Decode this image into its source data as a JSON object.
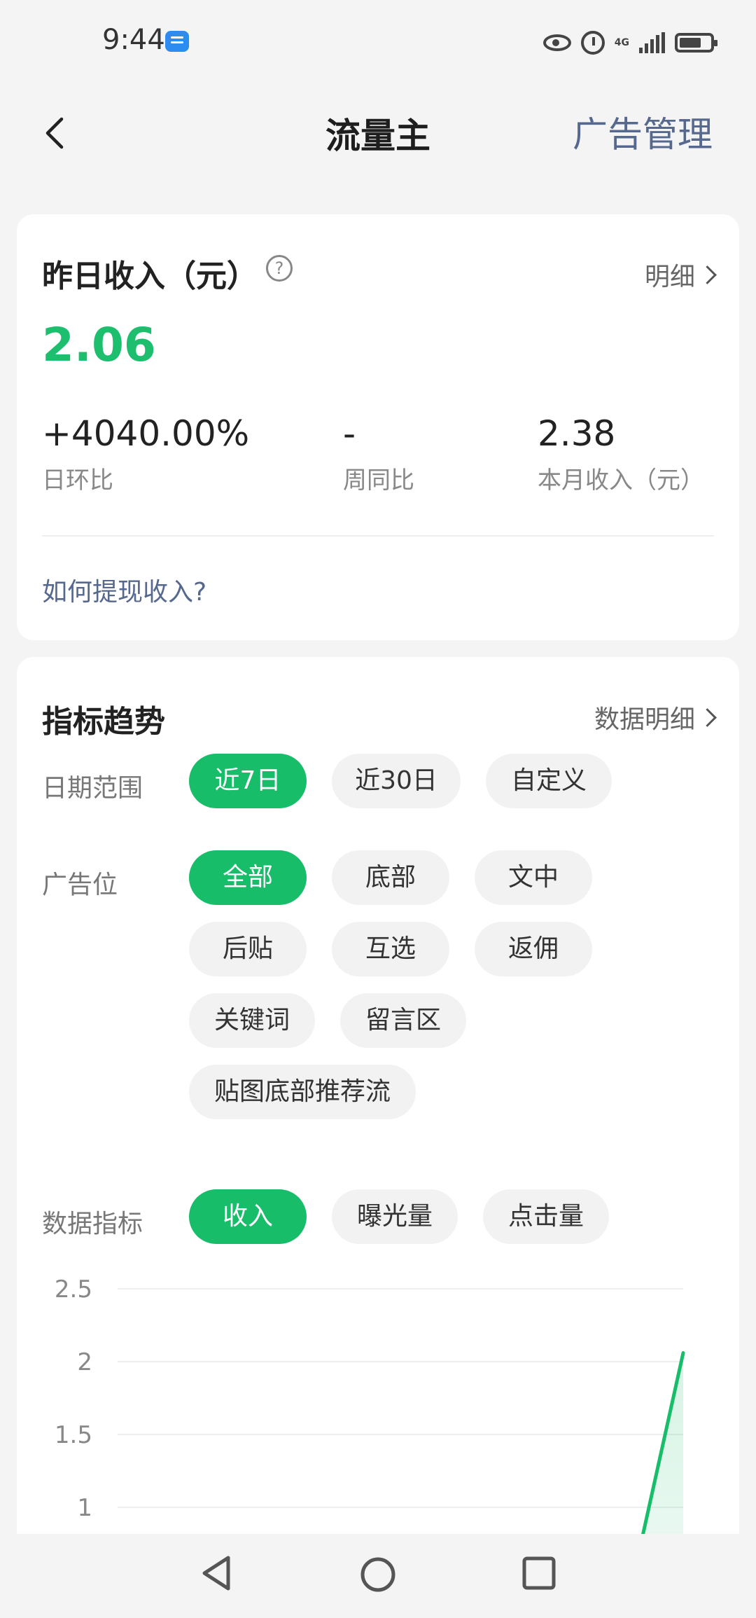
{
  "status_bar": {
    "time": "9:44",
    "network": "4G"
  },
  "header": {
    "title": "流量主",
    "right_link": "广告管理"
  },
  "summary": {
    "title": "昨日收入（元）",
    "detail_link": "明细",
    "yesterday_income": "2.06",
    "stats": [
      {
        "value": "+4040.00%",
        "label": "日环比"
      },
      {
        "value": "-",
        "label": "周同比"
      },
      {
        "value": "2.38",
        "label": "本月收入（元）"
      }
    ],
    "withdraw_link": "如何提现收入?"
  },
  "trends": {
    "title": "指标趋势",
    "detail_link": "数据明细",
    "date_range": {
      "label": "日期范围",
      "options": [
        "近7日",
        "近30日",
        "自定义"
      ],
      "selected": "近7日"
    },
    "ad_slot": {
      "label": "广告位",
      "options": [
        "全部",
        "底部",
        "文中",
        "后贴",
        "互选",
        "返佣",
        "关键词",
        "留言区",
        "贴图底部推荐流"
      ],
      "selected": "全部"
    },
    "metric": {
      "label": "数据指标",
      "options": [
        "收入",
        "曝光量",
        "点击量"
      ],
      "selected": "收入"
    }
  },
  "colors": {
    "accent": "#18bd69",
    "link": "#56688e"
  },
  "chart_data": {
    "type": "area",
    "yticks": [
      "2.5",
      "2",
      "1.5",
      "1"
    ],
    "ylim": [
      1,
      2.5
    ],
    "visible_segment": {
      "x_from_fraction_of_last_interval": 0.0,
      "y_end": 2.06
    }
  }
}
